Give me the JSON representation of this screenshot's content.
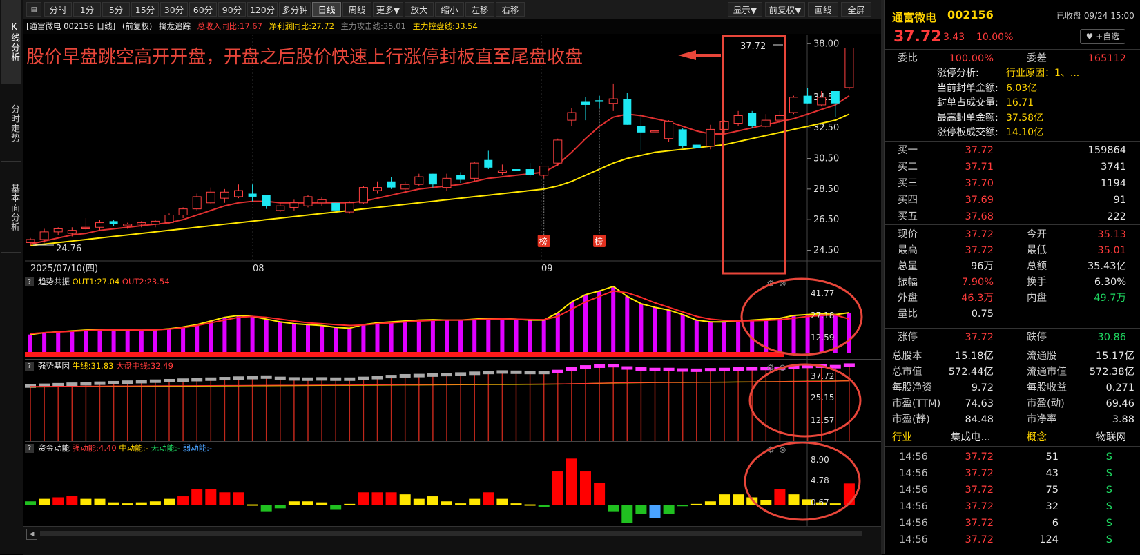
{
  "left_tabs": [
    "K线分析",
    "分时走势",
    "基本面分析"
  ],
  "toolbar": {
    "items": [
      "分时",
      "1分",
      "5分",
      "15分",
      "30分",
      "60分",
      "90分",
      "120分",
      "多分钟",
      "日线",
      "周线",
      "更多▼",
      "放大",
      "缩小",
      "左移",
      "右移"
    ],
    "active": "日线",
    "right_items": [
      "显示▼",
      "前复权▼",
      "画线",
      "全屏"
    ]
  },
  "info_bar": {
    "stock": "[通富微电 002156 日线]",
    "adjust": "(前复权)",
    "indicator": "擒龙追踪",
    "revenue": "总收入同比:17.67",
    "profit": "净利润同比:27.72",
    "attack": "主力攻击线:35.01",
    "control": "主力控盘线:33.54"
  },
  "annotation": "股价早盘跳空高开开盘，开盘之后股价快速上行涨停封板直至尾盘收盘",
  "main_chart": {
    "y_ticks": [
      "38.00",
      "34.50",
      "32.50",
      "30.50",
      "28.50",
      "26.50",
      "24.50"
    ],
    "x_labels": [
      "2025/07/10(四)",
      "08",
      "09"
    ],
    "high_label": "37.72",
    "low_label": "24.76",
    "bang_label": "榜"
  },
  "panel_trend": {
    "name": "趋势共振",
    "out1": "OUT1:27.04",
    "out2": "OUT2:23.54",
    "ticks": [
      "41.77",
      "27.18",
      "12.59"
    ]
  },
  "panel_strong": {
    "name": "强势基因",
    "bull": "牛线:31.83",
    "market": "大盘中线:32.49",
    "ticks": [
      "37.72",
      "25.15",
      "12.57"
    ]
  },
  "panel_fund": {
    "name": "资金动能",
    "strong": "强动能:4.40",
    "mid": "中动能:-",
    "none": "无动能:-",
    "weak": "弱动能:-",
    "ticks": [
      "8.90",
      "4.78",
      "0.67"
    ]
  },
  "chart_data": {
    "type": "candlestick",
    "candles": [
      [
        25.0,
        25.3,
        24.76,
        25.2
      ],
      [
        25.2,
        25.9,
        25.0,
        25.7
      ],
      [
        25.7,
        26.0,
        25.5,
        25.9
      ],
      [
        25.6,
        26.0,
        25.4,
        25.8
      ],
      [
        25.9,
        26.6,
        25.8,
        26.0
      ],
      [
        26.0,
        26.5,
        25.8,
        26.3
      ],
      [
        26.4,
        26.5,
        26.1,
        26.2
      ],
      [
        26.1,
        26.3,
        25.9,
        26.2
      ],
      [
        26.2,
        26.4,
        26.0,
        26.3
      ],
      [
        26.2,
        26.5,
        26.0,
        26.4
      ],
      [
        26.3,
        26.9,
        26.2,
        26.8
      ],
      [
        26.8,
        27.3,
        26.6,
        27.2
      ],
      [
        27.2,
        28.2,
        27.1,
        28.0
      ],
      [
        27.6,
        28.6,
        27.5,
        28.3
      ],
      [
        27.9,
        28.5,
        27.6,
        28.3
      ],
      [
        28.0,
        28.8,
        27.9,
        28.4
      ],
      [
        28.2,
        28.8,
        27.7,
        28.0
      ],
      [
        28.1,
        28.1,
        27.2,
        27.4
      ],
      [
        27.1,
        27.6,
        27.0,
        27.4
      ],
      [
        27.3,
        27.8,
        27.1,
        27.6
      ],
      [
        27.4,
        28.1,
        27.3,
        28.0
      ],
      [
        27.6,
        28.0,
        27.4,
        27.8
      ],
      [
        27.6,
        27.6,
        27.0,
        27.1
      ],
      [
        27.0,
        27.7,
        26.9,
        27.6
      ],
      [
        27.6,
        28.7,
        27.5,
        28.6
      ],
      [
        28.4,
        29.0,
        28.2,
        28.6
      ],
      [
        29.0,
        29.3,
        28.5,
        28.6
      ],
      [
        28.5,
        29.0,
        28.3,
        28.8
      ],
      [
        28.8,
        29.5,
        28.7,
        29.3
      ],
      [
        29.5,
        29.5,
        28.6,
        28.8
      ],
      [
        28.6,
        29.5,
        28.4,
        29.2
      ],
      [
        29.4,
        29.6,
        28.9,
        29.1
      ],
      [
        29.2,
        30.3,
        29.0,
        30.2
      ],
      [
        30.4,
        31.0,
        29.8,
        29.9
      ],
      [
        29.6,
        30.1,
        29.4,
        29.7
      ],
      [
        29.8,
        30.0,
        29.5,
        29.7
      ],
      [
        29.8,
        30.2,
        29.3,
        29.4
      ],
      [
        29.4,
        30.0,
        29.2,
        30.0
      ],
      [
        30.2,
        31.8,
        30.0,
        31.7
      ],
      [
        33.0,
        33.8,
        32.6,
        33.5
      ],
      [
        34.2,
        34.5,
        33.0,
        34.0
      ],
      [
        34.3,
        34.6,
        33.8,
        34.2
      ],
      [
        34.1,
        35.4,
        33.6,
        34.4
      ],
      [
        34.4,
        34.8,
        32.7,
        32.7
      ],
      [
        32.6,
        33.4,
        31.0,
        32.2
      ],
      [
        32.3,
        32.9,
        31.1,
        32.3
      ],
      [
        31.8,
        33.0,
        31.6,
        32.9
      ],
      [
        32.4,
        32.5,
        31.2,
        31.3
      ],
      [
        31.4,
        31.4,
        31.2,
        31.2
      ],
      [
        31.3,
        32.7,
        31.1,
        32.4
      ],
      [
        32.4,
        33.0,
        32.2,
        32.9
      ],
      [
        32.8,
        33.6,
        32.6,
        33.3
      ],
      [
        33.5,
        33.6,
        32.5,
        32.6
      ],
      [
        32.6,
        33.4,
        32.5,
        33.0
      ],
      [
        33.0,
        33.6,
        32.8,
        33.3
      ],
      [
        33.5,
        34.6,
        33.4,
        34.5
      ],
      [
        34.6,
        35.1,
        34.1,
        34.1
      ],
      [
        34.0,
        34.9,
        33.9,
        34.5
      ],
      [
        34.9,
        34.9,
        33.2,
        34.1
      ],
      [
        35.13,
        37.72,
        35.01,
        37.72
      ]
    ],
    "ma_fast": [
      24.9,
      25.1,
      25.3,
      25.5,
      25.6,
      25.8,
      25.9,
      26.0,
      26.1,
      26.2,
      26.3,
      26.5,
      26.8,
      27.1,
      27.4,
      27.6,
      27.7,
      27.7,
      27.6,
      27.6,
      27.6,
      27.6,
      27.6,
      27.6,
      27.7,
      27.9,
      28.1,
      28.3,
      28.5,
      28.6,
      28.7,
      28.8,
      29.0,
      29.2,
      29.3,
      29.4,
      29.5,
      29.6,
      30.1,
      30.9,
      31.8,
      32.6,
      33.2,
      33.4,
      33.3,
      33.1,
      32.9,
      32.6,
      32.3,
      32.1,
      32.1,
      32.3,
      32.5,
      32.7,
      32.9,
      33.1,
      33.4,
      33.7,
      34.0,
      34.6
    ],
    "ma_slow": [
      24.8,
      24.9,
      25.0,
      25.1,
      25.2,
      25.3,
      25.4,
      25.5,
      25.6,
      25.7,
      25.8,
      25.9,
      26.0,
      26.1,
      26.2,
      26.3,
      26.4,
      26.5,
      26.6,
      26.7,
      26.8,
      26.9,
      27.0,
      27.1,
      27.2,
      27.3,
      27.4,
      27.5,
      27.6,
      27.7,
      27.8,
      27.9,
      28.0,
      28.1,
      28.2,
      28.3,
      28.4,
      28.5,
      28.7,
      29.0,
      29.4,
      29.8,
      30.2,
      30.5,
      30.7,
      30.9,
      31.0,
      31.1,
      31.2,
      31.3,
      31.4,
      31.6,
      31.8,
      32.0,
      32.2,
      32.4,
      32.6,
      32.8,
      33.0,
      33.4
    ],
    "y_range": [
      23.8,
      38.6
    ],
    "bang_markers": [
      37,
      41
    ],
    "trend_out1": [
      15,
      16,
      16.5,
      17,
      17.5,
      17.8,
      17.6,
      17.5,
      17.4,
      17.6,
      18.2,
      19.2,
      20.5,
      22.5,
      24.5,
      25.5,
      25,
      23.5,
      22,
      21,
      20.5,
      20,
      19,
      18.5,
      20.5,
      21.5,
      22,
      22.5,
      23,
      23.2,
      23,
      23,
      23.5,
      24,
      23.8,
      23.5,
      23,
      23,
      27,
      33,
      37,
      39,
      41.5,
      36,
      32,
      30,
      28.5,
      26,
      23,
      22,
      22,
      22.5,
      23,
      23.5,
      24,
      25.5,
      26,
      26.5,
      26,
      27.04
    ],
    "trend_out2": [
      15.5,
      16,
      16.4,
      16.8,
      17.2,
      17.5,
      17.6,
      17.6,
      17.5,
      17.6,
      18,
      18.8,
      20,
      21.5,
      23,
      24.5,
      25,
      24.5,
      23.5,
      22.5,
      21.5,
      21,
      20.5,
      20,
      20.3,
      21,
      21.5,
      22,
      22.5,
      22.8,
      23,
      23,
      23.2,
      23.5,
      23.6,
      23.5,
      23.3,
      23.2,
      25,
      29,
      33,
      36,
      39,
      38,
      35.5,
      32.5,
      30,
      27.5,
      25,
      23.5,
      22.8,
      22.5,
      22.6,
      22.8,
      23.2,
      24,
      25,
      25.5,
      25.8,
      23.54
    ],
    "strong_bars": [
      29.5,
      29.8,
      30,
      30.2,
      30.4,
      30.6,
      30.8,
      31,
      31.2,
      31.4,
      31.6,
      31.8,
      32,
      32.2,
      32.4,
      32.6,
      32.8,
      33,
      32.5,
      32.3,
      32.2,
      32.3,
      32.2,
      32.2,
      32.5,
      32.8,
      33.2,
      33.5,
      33.6,
      33.8,
      34,
      34.2,
      34.5,
      34.8,
      35,
      34.9,
      34.8,
      34.8,
      35.2,
      36.2,
      37,
      37.3,
      37.5,
      36.6,
      36.2,
      36,
      36,
      35.8,
      35.7,
      35.9,
      36,
      36.2,
      36.3,
      36.4,
      36.5,
      37,
      37.2,
      37.3,
      37.1,
      37.72
    ],
    "fund_values": [
      0.8,
      1.3,
      1.6,
      1.9,
      1.3,
      1.3,
      0.6,
      0.4,
      0.6,
      0.8,
      1.3,
      1.8,
      3.3,
      3.3,
      2.6,
      2.6,
      0.2,
      -1.2,
      -0.6,
      0.8,
      0.8,
      0.6,
      -0.9,
      0.3,
      2.6,
      2.6,
      2.6,
      2.2,
      1.3,
      1.8,
      0.8,
      0.4,
      1.3,
      2.6,
      1.3,
      0.4,
      0.2,
      -0.1,
      6.8,
      9.4,
      6.8,
      4.5,
      -1.2,
      -3.5,
      -1.8,
      -2.5,
      -1.8,
      0.1,
      0.3,
      0.8,
      2.2,
      2.2,
      1.6,
      1.1,
      3.3,
      2.2,
      1.2,
      0.6,
      0.4,
      4.4
    ]
  },
  "right_panel": {
    "name": "通富微电",
    "code": "002156",
    "status": "已收盘 09/24 15:00",
    "price": "37.72",
    "change": "3.43",
    "pct": "10.00%",
    "watch": "+自选",
    "weibi_label": "委比",
    "weibi": "100.00%",
    "weicha_label": "委差",
    "weicha": "165112",
    "limit_info": [
      {
        "k": "涨停分析:",
        "v": "行业原因：1、..."
      },
      {
        "k": "当前封单金额:",
        "v": "6.03亿"
      },
      {
        "k": "封单占成交量:",
        "v": "16.71"
      },
      {
        "k": "最高封单金额:",
        "v": "37.58亿"
      },
      {
        "k": "涨停板成交额:",
        "v": "14.10亿"
      }
    ],
    "bids": [
      {
        "k": "买一",
        "p": "37.72",
        "v": "159864"
      },
      {
        "k": "买二",
        "p": "37.71",
        "v": "3741"
      },
      {
        "k": "买三",
        "p": "37.70",
        "v": "1194"
      },
      {
        "k": "买四",
        "p": "37.69",
        "v": "91"
      },
      {
        "k": "买五",
        "p": "37.68",
        "v": "222"
      }
    ],
    "quote": [
      {
        "k1": "现价",
        "v1": "37.72",
        "c1": "red",
        "k2": "今开",
        "v2": "35.13",
        "c2": "red"
      },
      {
        "k1": "最高",
        "v1": "37.72",
        "c1": "red",
        "k2": "最低",
        "v2": "35.01",
        "c2": "red"
      },
      {
        "k1": "总量",
        "v1": "96万",
        "c1": "white",
        "k2": "总额",
        "v2": "35.43亿",
        "c2": "white"
      },
      {
        "k1": "振幅",
        "v1": "7.90%",
        "c1": "red",
        "k2": "换手",
        "v2": "6.30%",
        "c2": "white"
      },
      {
        "k1": "外盘",
        "v1": "46.3万",
        "c1": "red",
        "k2": "内盘",
        "v2": "49.7万",
        "c2": "green"
      },
      {
        "k1": "量比",
        "v1": "0.75",
        "c1": "white",
        "k2": "",
        "v2": "",
        "c2": "white"
      }
    ],
    "limits": {
      "k1": "涨停",
      "v1": "37.72",
      "k2": "跌停",
      "v2": "30.86"
    },
    "fundamentals": [
      {
        "k1": "总股本",
        "v1": "15.18亿",
        "k2": "流通股",
        "v2": "15.17亿"
      },
      {
        "k1": "总市值",
        "v1": "572.44亿",
        "k2": "流通市值",
        "v2": "572.38亿"
      },
      {
        "k1": "每股净资",
        "v1": "9.72",
        "k2": "每股收益",
        "v2": "0.271"
      },
      {
        "k1": "市盈(TTM)",
        "v1": "74.63",
        "k2": "市盈(动)",
        "v2": "69.46"
      },
      {
        "k1": "市盈(静)",
        "v1": "84.48",
        "k2": "市净率",
        "v2": "3.88"
      }
    ],
    "industry": {
      "k1": "行业",
      "v1": "集成电...",
      "k2": "概念",
      "v2": "物联网"
    },
    "ticks": [
      {
        "t": "14:56",
        "p": "37.72",
        "v": "51",
        "s": "S"
      },
      {
        "t": "14:56",
        "p": "37.72",
        "v": "43",
        "s": "S"
      },
      {
        "t": "14:56",
        "p": "37.72",
        "v": "75",
        "s": "S"
      },
      {
        "t": "14:56",
        "p": "37.72",
        "v": "32",
        "s": "S"
      },
      {
        "t": "14:56",
        "p": "37.72",
        "v": "6",
        "s": "S"
      },
      {
        "t": "14:56",
        "p": "37.72",
        "v": "124",
        "s": "S"
      }
    ]
  }
}
